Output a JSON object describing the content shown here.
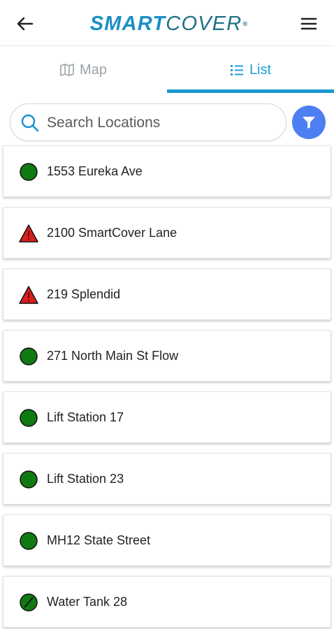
{
  "header": {
    "logo_smart": "SMART",
    "logo_cover": "COVER",
    "logo_reg": "®",
    "colors": {
      "smart": "#1a8fc4",
      "cover": "#1f6f86"
    }
  },
  "tabs": [
    {
      "label": "Map",
      "icon": "map-icon",
      "active": false
    },
    {
      "label": "List",
      "icon": "list-icon",
      "active": true
    }
  ],
  "search": {
    "placeholder": "Search Locations",
    "value": ""
  },
  "filter": {
    "icon": "filter-icon",
    "color": "#4d7ef2"
  },
  "status_colors": {
    "ok": "#0f7a12",
    "alarm": "#d81f1f",
    "offline": "#0f7a12"
  },
  "locations": [
    {
      "name": "1553 Eureka Ave",
      "status": "ok"
    },
    {
      "name": "2100 SmartCover Lane",
      "status": "alarm"
    },
    {
      "name": "219 Splendid",
      "status": "alarm"
    },
    {
      "name": "271 North Main St Flow",
      "status": "ok"
    },
    {
      "name": "Lift Station 17",
      "status": "ok"
    },
    {
      "name": "Lift Station 23",
      "status": "ok"
    },
    {
      "name": "MH12 State Street",
      "status": "ok"
    },
    {
      "name": "Water Tank 28",
      "status": "offline"
    }
  ]
}
